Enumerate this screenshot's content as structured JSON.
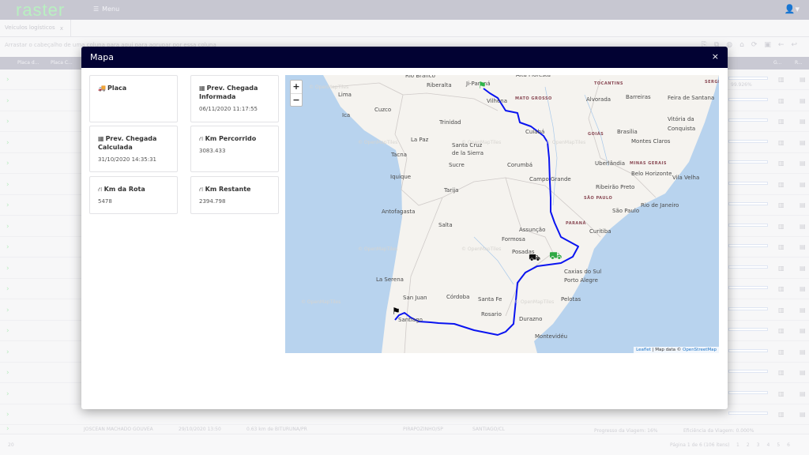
{
  "app": {
    "logo": "raster",
    "menu_label": "Menu",
    "user_icon": "user-icon"
  },
  "tab": {
    "label": "Veículos logísticos",
    "close": "x"
  },
  "grid": {
    "group_hint": "Arrastar o cabeçalho de uma coluna para aqui para agrupar por essa coluna",
    "columns": [
      "Placa d...",
      "Placa C...",
      "G...",
      "R..."
    ],
    "last_row": {
      "driver": "JOSCEAN MACHADO GOUVEA",
      "date": "29/10/2020 13:50",
      "location": "0.63 km de BITURUNA/PR",
      "origin": "PIRAPOZINHO/SP",
      "destination": "SANTIAGO/CL",
      "progress": "Progresso da Viagem: 16%",
      "efficiency": "Eficiência da Viagem: 0.000%"
    },
    "visible_percent": "99.926%",
    "page_size": "20",
    "pager_info": "Página 1 de 6 (106 itens)",
    "pages": [
      "1",
      "2",
      "3",
      "4",
      "5",
      "6"
    ]
  },
  "modal": {
    "title": "Mapa",
    "close": "×",
    "cards": [
      {
        "label": "Placa",
        "value": "",
        "icon": "truck-icon"
      },
      {
        "label": "Prev. Chegada Informada",
        "value": "06/11/2020 11:17:55",
        "icon": "calendar-icon"
      },
      {
        "label": "Prev. Chegada Calculada",
        "value": "31/10/2020 14:35:31",
        "icon": "calendar-icon"
      },
      {
        "label": "Km Percorrido",
        "value": "3083.433",
        "icon": "route-icon"
      },
      {
        "label": "Km da Rota",
        "value": "5478",
        "icon": "route-icon"
      },
      {
        "label": "Km Restante",
        "value": "2394.798",
        "icon": "route-icon"
      }
    ],
    "map": {
      "zoom_in": "+",
      "zoom_out": "−",
      "watermark": "© OpenMapTiles",
      "attribution_leaflet": "Leaflet",
      "attribution_text": " | Map data © ",
      "attribution_osm": "OpenStreetMap",
      "route_color": "#0a14f0",
      "cities": [
        "Rio Branco",
        "Riberalta",
        "Ji-Paraná",
        "Alta Floresta",
        "Lima",
        "Barreiras",
        "Feira de Santana",
        "Vilhena",
        "Alvorada",
        "Cuzco",
        "Ica",
        "Vitória da",
        "Conquista",
        "Trinidad",
        "Cuiabá",
        "Brasília",
        "Montes Claros",
        "La Paz",
        "Santa Cruz",
        "de la Sierra",
        "Tacna",
        "Sucre",
        "Corumbá",
        "Uberlândia",
        "Belo Horizonte",
        "Vila Velha",
        "Campo Grande",
        "Iquique",
        "Tarija",
        "Ribeirão Preto",
        "Rio de Janeiro",
        "São Paulo",
        "Antofagasta",
        "Salta",
        "Assunção",
        "Curitiba",
        "Formosa",
        "Posadas",
        "Caxias do Sul",
        "Porto Alegre",
        "La Serena",
        "San Juan",
        "Córdoba",
        "Santa Fe",
        "Pelotas",
        "Rosario",
        "Santiago",
        "Durazno",
        "Montevidéu"
      ],
      "states": [
        "TOCANTINS",
        "SERGIPE",
        "MATO GROSSO",
        "GOIÁS",
        "MINAS GERAIS",
        "SÃO PAULO",
        "PARANÁ"
      ]
    }
  }
}
